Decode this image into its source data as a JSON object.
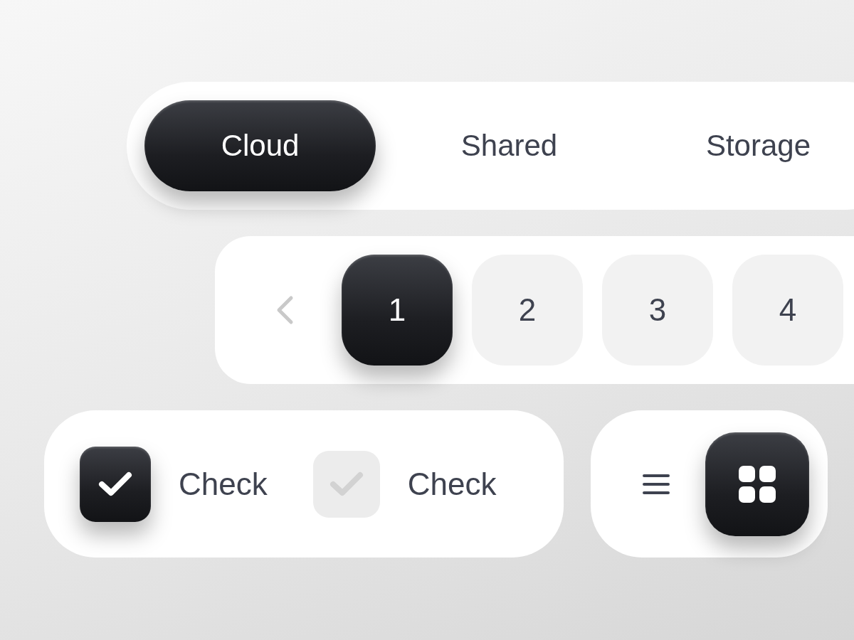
{
  "tabs": [
    {
      "label": "Cloud",
      "selected": true
    },
    {
      "label": "Shared",
      "selected": false
    },
    {
      "label": "Storage",
      "selected": false
    }
  ],
  "pagination": {
    "pages": [
      {
        "label": "1",
        "selected": true
      },
      {
        "label": "2",
        "selected": false
      },
      {
        "label": "3",
        "selected": false
      },
      {
        "label": "4",
        "selected": false
      }
    ]
  },
  "checkboxes": [
    {
      "label": "Check",
      "checked": true
    },
    {
      "label": "Check",
      "checked": false
    }
  ],
  "view_toggle": [
    {
      "kind": "list",
      "selected": false
    },
    {
      "kind": "grid",
      "selected": true
    }
  ]
}
